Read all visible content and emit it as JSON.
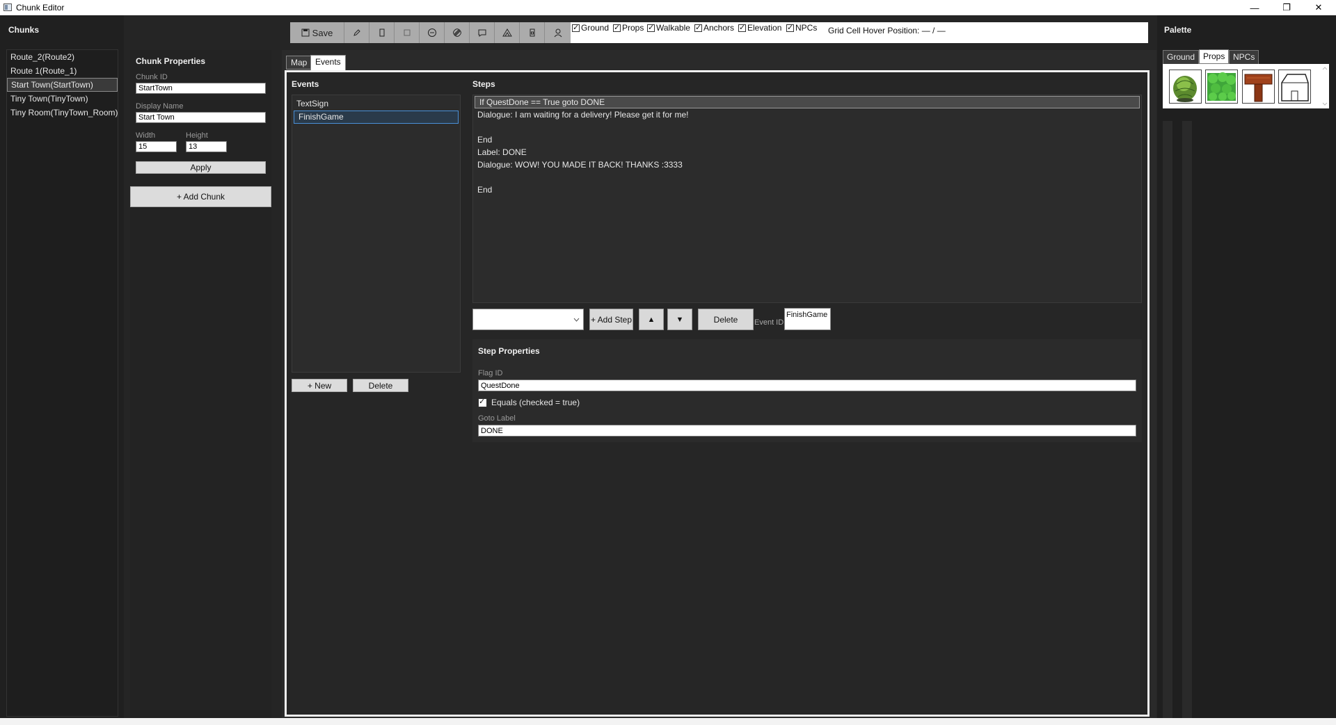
{
  "window": {
    "title": "Chunk Editor",
    "minimize_glyph": "—",
    "maximize_glyph": "❐",
    "close_glyph": "✕"
  },
  "chunks": {
    "title": "Chunks",
    "items": [
      {
        "label": "Route_2(Route2)",
        "selected": false
      },
      {
        "label": "Route 1(Route_1)",
        "selected": false
      },
      {
        "label": "Start Town(StartTown)",
        "selected": true
      },
      {
        "label": "Tiny Town(TinyTown)",
        "selected": false
      },
      {
        "label": "Tiny Room(TinyTown_Room)",
        "selected": false
      }
    ]
  },
  "chunk_properties": {
    "title": "Chunk Properties",
    "chunk_id_label": "Chunk ID",
    "chunk_id_value": "StartTown",
    "display_name_label": "Display Name",
    "display_name_value": "Start Town",
    "width_label": "Width",
    "width_value": "15",
    "height_label": "Height",
    "height_value": "13",
    "apply_label": "Apply",
    "add_chunk_label": "+ Add Chunk"
  },
  "toolbar": {
    "save_label": "Save",
    "tools": [
      "pencil-icon",
      "rect-icon",
      "fill-icon",
      "eraser-icon",
      "tag-icon",
      "speech-icon",
      "warp-icon",
      "door-icon",
      "npc-icon"
    ],
    "layers": [
      {
        "label": "Ground",
        "checked": true
      },
      {
        "label": "Props",
        "checked": true
      },
      {
        "label": "Walkable",
        "checked": true
      },
      {
        "label": "Anchors",
        "checked": true
      },
      {
        "label": "Elevation",
        "checked": true
      },
      {
        "label": "NPCs",
        "checked": true
      }
    ],
    "hover_position": "Grid Cell Hover Position: — / —"
  },
  "tabs": [
    {
      "label": "Map",
      "active": false
    },
    {
      "label": "Events",
      "active": true
    }
  ],
  "events": {
    "title": "Events",
    "items": [
      {
        "label": "TextSign",
        "selected": false
      },
      {
        "label": "FinishGame",
        "selected": true
      }
    ],
    "new_label": "+ New",
    "delete_label": "Delete"
  },
  "steps": {
    "title": "Steps",
    "items": [
      {
        "label": "If QuestDone == True goto DONE",
        "selected": true
      },
      {
        "label": "Dialogue: I am waiting for a delivery! Please get it for me!",
        "selected": false
      },
      {
        "label": "",
        "selected": false
      },
      {
        "label": "End",
        "selected": false
      },
      {
        "label": "Label: DONE",
        "selected": false
      },
      {
        "label": "Dialogue: WOW! YOU MADE IT BACK! THANKS :3333",
        "selected": false
      },
      {
        "label": "",
        "selected": false
      },
      {
        "label": "End",
        "selected": false
      }
    ],
    "step_type_value": "",
    "add_step_label": "+ Add Step",
    "up_glyph": "▲",
    "down_glyph": "▼",
    "delete_label": "Delete",
    "event_id_label": "Event ID",
    "event_id_value": "FinishGame"
  },
  "step_properties": {
    "title": "Step Properties",
    "flag_id_label": "Flag ID",
    "flag_id_value": "QuestDone",
    "equals_label": "Equals (checked = true)",
    "equals_checked": true,
    "goto_label_label": "Goto Label",
    "goto_label_value": "DONE"
  },
  "palette": {
    "title": "Palette",
    "tabs": [
      {
        "label": "Ground",
        "active": false
      },
      {
        "label": "Props",
        "active": true
      },
      {
        "label": "NPCs",
        "active": false
      }
    ],
    "tiles": [
      "bush-icon",
      "shrub-icon",
      "signpost-icon",
      "house-icon"
    ]
  }
}
